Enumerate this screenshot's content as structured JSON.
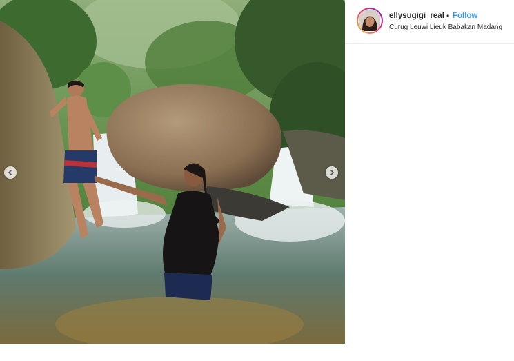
{
  "post": {
    "username": "ellysugigi_real_",
    "separator": "•",
    "follow_label": "Follow",
    "location": "Curug Leuwi Lieuk Babakan Madang"
  },
  "photo": {
    "icon_prev": "chevron-left-icon",
    "icon_next": "chevron-right-icon"
  },
  "colors": {
    "follow": "#3897f0",
    "text": "#262626",
    "divider": "#efefef"
  }
}
